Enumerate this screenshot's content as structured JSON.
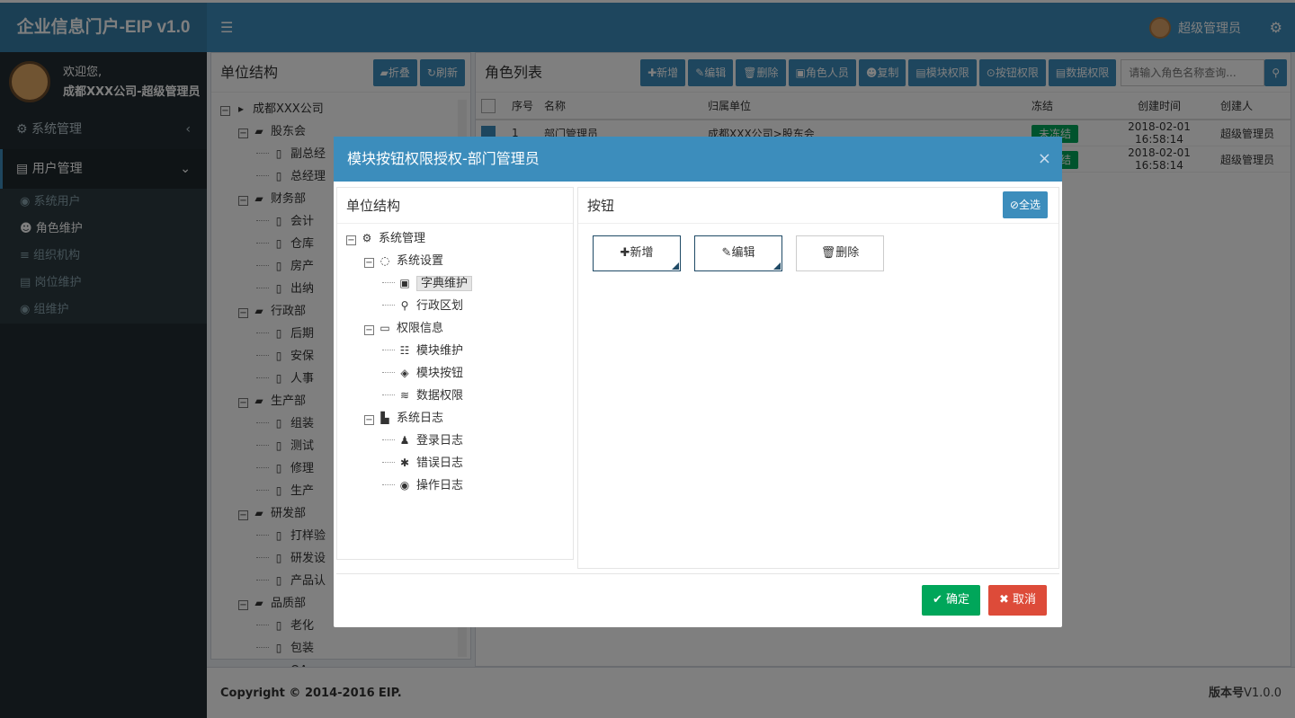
{
  "app": {
    "title": "企业信息门户-EIP v1.0",
    "user": "超级管理员"
  },
  "sidebar": {
    "welcome": "欢迎您,",
    "org_user": "成都XXX公司-超级管理员",
    "menus": [
      {
        "label": "系统管理",
        "arrow": "‹"
      },
      {
        "label": "用户管理",
        "arrow": "⌄"
      }
    ],
    "items": [
      {
        "label": "系统用户"
      },
      {
        "label": "角色维护"
      },
      {
        "label": "组织机构"
      },
      {
        "label": "岗位维护"
      },
      {
        "label": "组维护"
      }
    ]
  },
  "left_panel": {
    "title": "单位结构",
    "collapse": "折叠",
    "refresh": "刷新",
    "root": "成都XXX公司",
    "nodes": [
      {
        "label": "股东会",
        "children": [
          "副总经",
          "总经理"
        ]
      },
      {
        "label": "财务部",
        "children": [
          "会计",
          "仓库",
          "房产",
          "出纳"
        ]
      },
      {
        "label": "行政部",
        "children": [
          "后期",
          "安保",
          "人事"
        ]
      },
      {
        "label": "生产部",
        "children": [
          "组装",
          "测试",
          "修理",
          "生产"
        ]
      },
      {
        "label": "研发部",
        "children": [
          "打样验",
          "研发设",
          "产品认"
        ]
      },
      {
        "label": "品质部",
        "children": [
          "老化",
          "包装",
          "QA"
        ]
      }
    ]
  },
  "role_panel": {
    "title": "角色列表",
    "buttons": [
      "新增",
      "编辑",
      "删除",
      "角色人员",
      "复制",
      "模块权限",
      "按钮权限",
      "数据权限"
    ],
    "search_placeholder": "请输入角色名称查询...",
    "headers": [
      "序号",
      "名称",
      "归属单位",
      "冻结",
      "创建时间",
      "创建人"
    ],
    "rows": [
      {
        "no": "1",
        "name": "部门管理员",
        "unit": "成都XXX公司>股东会",
        "status": "未冻结",
        "time": "2018-02-01 16:58:14",
        "creator": "超级管理员"
      },
      {
        "no": "2",
        "name": "",
        "unit": "",
        "status": "未冻结",
        "time": "2018-02-01 16:58:14",
        "creator": "超级管理员"
      }
    ]
  },
  "footer": {
    "copyright": "Copyright © 2014-2016",
    "brand": "EIP.",
    "version_label": "版本号",
    "version": "V1.0.0"
  },
  "modal": {
    "title": "模块按钮权限授权-部门管理员",
    "close": "×",
    "left_title": "单位结构",
    "right_title": "按钮",
    "select_all": "全选",
    "tree": {
      "root": "系统管理",
      "groups": [
        {
          "label": "系统设置",
          "children": [
            "字典维护",
            "行政区划"
          ]
        },
        {
          "label": "权限信息",
          "children": [
            "模块维护",
            "模块按钮",
            "数据权限"
          ]
        },
        {
          "label": "系统日志",
          "children": [
            "登录日志",
            "错误日志",
            "操作日志"
          ]
        }
      ]
    },
    "buttons": [
      "新增",
      "编辑",
      "删除"
    ],
    "ok": "确定",
    "cancel": "取消"
  }
}
